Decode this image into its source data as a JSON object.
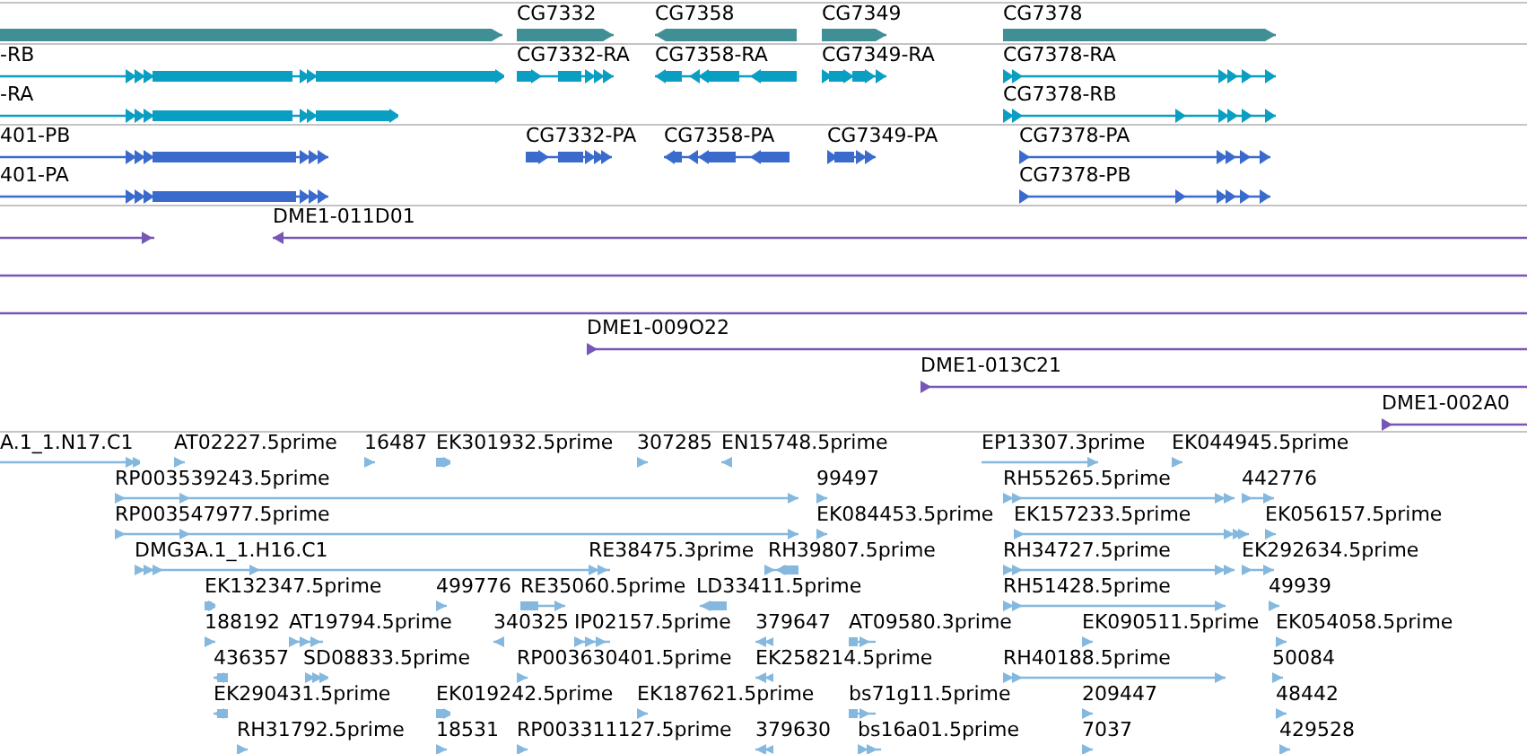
{
  "tracks": [
    {
      "kind": "gene",
      "rows": [
        {
          "features": [
            {
              "reverse": false
            },
            {
              "label": "CG7332",
              "reverse": false
            },
            {
              "label": "CG7358",
              "reverse": true
            },
            {
              "label": "CG7349",
              "reverse": false
            },
            {
              "label": "CG7378",
              "reverse": false
            }
          ]
        }
      ]
    },
    {
      "kind": "transcript",
      "rows": [
        {
          "features": [
            {
              "label": "-RB",
              "reverse": false
            },
            {
              "label": "CG7332-RA",
              "reverse": false
            },
            {
              "label": "CG7358-RA",
              "reverse": true
            },
            {
              "label": "CG7349-RA",
              "reverse": false
            },
            {
              "label": "CG7378-RA",
              "reverse": false
            }
          ]
        },
        {
          "features": [
            {
              "label": "-RA",
              "reverse": false
            },
            {
              "label": "CG7378-RB",
              "reverse": false
            }
          ]
        }
      ]
    },
    {
      "kind": "protein",
      "rows": [
        {
          "features": [
            {
              "label": "401-PB",
              "reverse": false
            },
            {
              "label": "CG7332-PA",
              "reverse": false
            },
            {
              "label": "CG7358-PA",
              "reverse": true
            },
            {
              "label": "CG7349-PA",
              "reverse": false
            },
            {
              "label": "CG7378-PA",
              "reverse": false
            }
          ]
        },
        {
          "features": [
            {
              "label": "401-PA",
              "reverse": false
            },
            {
              "label": "CG7378-PB",
              "reverse": false
            }
          ]
        }
      ]
    },
    {
      "kind": "clone",
      "rows": [
        {
          "features": [
            {
              "reverse": false
            },
            {
              "label": "DME1-011D01",
              "reverse": true
            }
          ]
        },
        {
          "features": [
            {
              "headless": true
            }
          ]
        },
        {
          "features": [
            {
              "headless": true
            }
          ]
        },
        {
          "features": [
            {
              "label": "DME1-009O22",
              "reverse": false
            }
          ]
        },
        {
          "features": [
            {
              "label": "DME1-013C21",
              "reverse": false
            }
          ]
        },
        {
          "features": [
            {
              "label": "DME1-002A0",
              "reverse": false
            }
          ]
        }
      ]
    },
    {
      "kind": "est",
      "rows": [
        {
          "features": [
            {
              "label": "A.1_1.N17.C1",
              "reverse": false
            },
            {
              "label": "AT02227.5prime",
              "reverse": false
            },
            {
              "label": "16487",
              "reverse": false
            },
            {
              "label": "EK301932.5prime",
              "reverse": false
            },
            {
              "label": "307285",
              "reverse": false
            },
            {
              "label": "EN15748.5prime",
              "reverse": true
            },
            {
              "label": "EP13307.3prime",
              "reverse": false
            },
            {
              "label": "EK044945.5prime",
              "reverse": false
            }
          ]
        },
        {
          "features": [
            {
              "label": "RP003539243.5prime",
              "reverse": false
            },
            {
              "label": "99497",
              "reverse": false
            },
            {
              "label": "RH55265.5prime",
              "reverse": false
            },
            {
              "label": "442776",
              "reverse": false
            }
          ]
        },
        {
          "features": [
            {
              "label": "RP003547977.5prime",
              "reverse": false
            },
            {
              "label": "EK084453.5prime",
              "reverse": false
            },
            {
              "label": "EK157233.5prime",
              "reverse": false
            },
            {
              "label": "EK056157.5prime",
              "reverse": false
            }
          ]
        },
        {
          "features": [
            {
              "label": "DMG3A.1_1.H16.C1",
              "reverse": false
            },
            {
              "label": "RE38475.3prime",
              "reverse": false
            },
            {
              "label": "RH39807.5prime",
              "reverse": true
            },
            {
              "label": "RH34727.5prime",
              "reverse": false
            },
            {
              "label": "EK292634.5prime",
              "reverse": false
            }
          ]
        },
        {
          "features": [
            {
              "label": "EK132347.5prime",
              "reverse": false
            },
            {
              "label": "499776",
              "reverse": false
            },
            {
              "label": "RE35060.5prime",
              "reverse": false
            },
            {
              "label": "LD33411.5prime",
              "reverse": true
            },
            {
              "label": "RH51428.5prime",
              "reverse": false
            },
            {
              "label": "49939",
              "reverse": false
            }
          ]
        },
        {
          "features": [
            {
              "label": "188192",
              "reverse": false
            },
            {
              "label": "AT19794.5prime",
              "reverse": false
            },
            {
              "label": "340325",
              "reverse": true
            },
            {
              "label": "IP02157.5prime",
              "reverse": false
            },
            {
              "label": "379647",
              "reverse": true
            },
            {
              "label": "AT09580.3prime",
              "reverse": false
            },
            {
              "label": "EK090511.5prime",
              "reverse": false
            },
            {
              "label": "EK054058.5prime",
              "reverse": false
            }
          ]
        },
        {
          "features": [
            {
              "label": "436357",
              "reverse": true
            },
            {
              "label": "SD08833.5prime",
              "reverse": false
            },
            {
              "label": "RP003630401.5prime",
              "reverse": false
            },
            {
              "label": "EK258214.5prime",
              "reverse": true
            },
            {
              "label": "RH40188.5prime",
              "reverse": false
            },
            {
              "label": "50084",
              "reverse": false
            }
          ]
        },
        {
          "features": [
            {
              "label": "EK290431.5prime",
              "reverse": true
            },
            {
              "label": "EK019242.5prime",
              "reverse": false
            },
            {
              "label": "EK187621.5prime",
              "reverse": false
            },
            {
              "label": "bs71g11.5prime",
              "reverse": false
            },
            {
              "label": "209447",
              "reverse": false
            },
            {
              "label": "48442",
              "reverse": false
            }
          ]
        },
        {
          "features": [
            {
              "label": "RH31792.5prime",
              "reverse": false
            },
            {
              "label": "18531",
              "reverse": false
            },
            {
              "label": "RP003311127.5prime",
              "reverse": false
            },
            {
              "label": "379630",
              "reverse": true
            },
            {
              "label": "bs16a01.5prime",
              "reverse": false
            },
            {
              "label": "7037",
              "reverse": false
            },
            {
              "label": "429528",
              "reverse": false
            }
          ]
        }
      ]
    }
  ]
}
